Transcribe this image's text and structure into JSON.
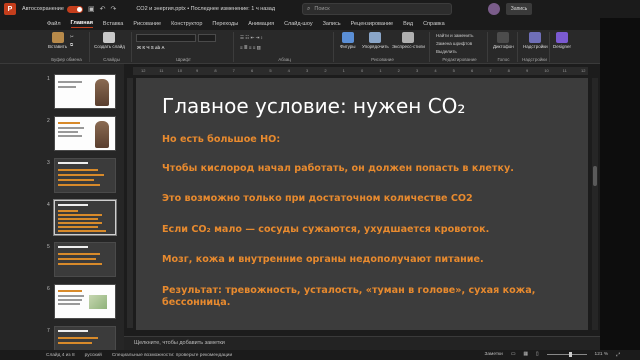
{
  "titlebar": {
    "autosave_label": "Автосохранение",
    "document_title": "CO2 и энергия.pptx • Последнее изменение: 1 ч назад",
    "search_placeholder": "Поиск",
    "saved_label": "Запись"
  },
  "menu": {
    "tabs": [
      "Файл",
      "Главная",
      "Вставка",
      "Рисование",
      "Конструктор",
      "Переходы",
      "Анимация",
      "Слайд-шоу",
      "Запись",
      "Рецензирование",
      "Вид",
      "Справка"
    ],
    "active_index": 1
  },
  "ribbon": {
    "paste_label": "Вставить",
    "new_slide_label": "Создать слайд",
    "reuse_slides_label": "Повторно использовать слайды",
    "clipboard_group": "Буфер обмена",
    "slides_group": "Слайды",
    "font_group": "Шрифт",
    "paragraph_group": "Абзац",
    "shapes_label": "Фигуры",
    "arrange_label": "Упорядочить",
    "quick_styles_label": "Экспресс-стили",
    "drawing_group": "Рисование",
    "find_label": "Найти и заменить",
    "replace_label": "Замена шрифтов",
    "select_label": "Выделить",
    "editing_group": "Редактирование",
    "dictate_label": "Диктофон",
    "voice_group": "Голос",
    "addins_label": "Надстройки",
    "addins_group": "Надстройки",
    "designer_label": "Designer"
  },
  "thumbnails": [
    {
      "num": "1",
      "style": "light-photo"
    },
    {
      "num": "2",
      "style": "light-photo"
    },
    {
      "num": "3",
      "style": "dark"
    },
    {
      "num": "4",
      "style": "dark",
      "selected": true
    },
    {
      "num": "5",
      "style": "dark"
    },
    {
      "num": "6",
      "style": "light-chart"
    },
    {
      "num": "7",
      "style": "dark"
    }
  ],
  "ruler": [
    "12",
    "11",
    "10",
    "9",
    "8",
    "7",
    "6",
    "5",
    "4",
    "3",
    "2",
    "1",
    "0",
    "1",
    "2",
    "3",
    "4",
    "5",
    "6",
    "7",
    "8",
    "9",
    "10",
    "11",
    "12"
  ],
  "slide": {
    "title": "Главное условие: нужен СО₂",
    "paragraphs": [
      "Но есть большое НО:",
      "Чтобы кислород начал работать, он должен попасть в клетку.",
      "Это возможно только при достаточном количестве СО2",
      "Если СО₂ мало — сосуды сужаются, ухудшается кровоток.",
      "Мозг, кожа и внутренние органы недополучают питание.",
      "Результат: тревожность, усталость, «туман в голове», сухая кожа, бессонница."
    ],
    "title_color": "#ffffff",
    "body_color": "#e88a2e",
    "background": "#3c3c3c"
  },
  "notes_placeholder": "Щелкните, чтобы добавить заметки",
  "statusbar": {
    "slide_counter": "Слайд 4 из 8",
    "language": "русский",
    "accessibility": "Специальные возможности: проверьте рекомендации",
    "notes_button": "Заметки",
    "zoom": "121 %"
  }
}
